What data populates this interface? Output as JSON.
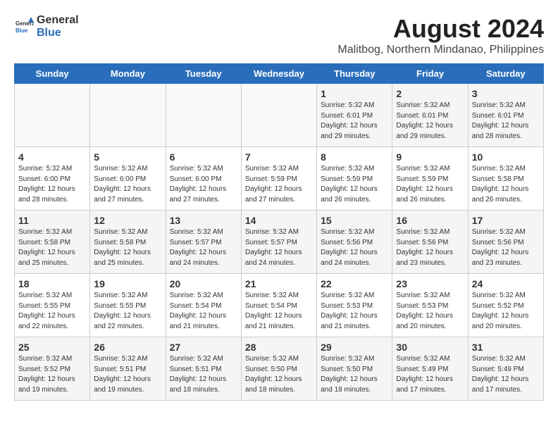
{
  "logo": {
    "text_general": "General",
    "text_blue": "Blue"
  },
  "title": "August 2024",
  "subtitle": "Malitbog, Northern Mindanao, Philippines",
  "headers": [
    "Sunday",
    "Monday",
    "Tuesday",
    "Wednesday",
    "Thursday",
    "Friday",
    "Saturday"
  ],
  "weeks": [
    [
      {
        "day": "",
        "content": ""
      },
      {
        "day": "",
        "content": ""
      },
      {
        "day": "",
        "content": ""
      },
      {
        "day": "",
        "content": ""
      },
      {
        "day": "1",
        "content": "Sunrise: 5:32 AM\nSunset: 6:01 PM\nDaylight: 12 hours\nand 29 minutes."
      },
      {
        "day": "2",
        "content": "Sunrise: 5:32 AM\nSunset: 6:01 PM\nDaylight: 12 hours\nand 29 minutes."
      },
      {
        "day": "3",
        "content": "Sunrise: 5:32 AM\nSunset: 6:01 PM\nDaylight: 12 hours\nand 28 minutes."
      }
    ],
    [
      {
        "day": "4",
        "content": "Sunrise: 5:32 AM\nSunset: 6:00 PM\nDaylight: 12 hours\nand 28 minutes."
      },
      {
        "day": "5",
        "content": "Sunrise: 5:32 AM\nSunset: 6:00 PM\nDaylight: 12 hours\nand 27 minutes."
      },
      {
        "day": "6",
        "content": "Sunrise: 5:32 AM\nSunset: 6:00 PM\nDaylight: 12 hours\nand 27 minutes."
      },
      {
        "day": "7",
        "content": "Sunrise: 5:32 AM\nSunset: 5:59 PM\nDaylight: 12 hours\nand 27 minutes."
      },
      {
        "day": "8",
        "content": "Sunrise: 5:32 AM\nSunset: 5:59 PM\nDaylight: 12 hours\nand 26 minutes."
      },
      {
        "day": "9",
        "content": "Sunrise: 5:32 AM\nSunset: 5:59 PM\nDaylight: 12 hours\nand 26 minutes."
      },
      {
        "day": "10",
        "content": "Sunrise: 5:32 AM\nSunset: 5:58 PM\nDaylight: 12 hours\nand 26 minutes."
      }
    ],
    [
      {
        "day": "11",
        "content": "Sunrise: 5:32 AM\nSunset: 5:58 PM\nDaylight: 12 hours\nand 25 minutes."
      },
      {
        "day": "12",
        "content": "Sunrise: 5:32 AM\nSunset: 5:58 PM\nDaylight: 12 hours\nand 25 minutes."
      },
      {
        "day": "13",
        "content": "Sunrise: 5:32 AM\nSunset: 5:57 PM\nDaylight: 12 hours\nand 24 minutes."
      },
      {
        "day": "14",
        "content": "Sunrise: 5:32 AM\nSunset: 5:57 PM\nDaylight: 12 hours\nand 24 minutes."
      },
      {
        "day": "15",
        "content": "Sunrise: 5:32 AM\nSunset: 5:56 PM\nDaylight: 12 hours\nand 24 minutes."
      },
      {
        "day": "16",
        "content": "Sunrise: 5:32 AM\nSunset: 5:56 PM\nDaylight: 12 hours\nand 23 minutes."
      },
      {
        "day": "17",
        "content": "Sunrise: 5:32 AM\nSunset: 5:56 PM\nDaylight: 12 hours\nand 23 minutes."
      }
    ],
    [
      {
        "day": "18",
        "content": "Sunrise: 5:32 AM\nSunset: 5:55 PM\nDaylight: 12 hours\nand 22 minutes."
      },
      {
        "day": "19",
        "content": "Sunrise: 5:32 AM\nSunset: 5:55 PM\nDaylight: 12 hours\nand 22 minutes."
      },
      {
        "day": "20",
        "content": "Sunrise: 5:32 AM\nSunset: 5:54 PM\nDaylight: 12 hours\nand 21 minutes."
      },
      {
        "day": "21",
        "content": "Sunrise: 5:32 AM\nSunset: 5:54 PM\nDaylight: 12 hours\nand 21 minutes."
      },
      {
        "day": "22",
        "content": "Sunrise: 5:32 AM\nSunset: 5:53 PM\nDaylight: 12 hours\nand 21 minutes."
      },
      {
        "day": "23",
        "content": "Sunrise: 5:32 AM\nSunset: 5:53 PM\nDaylight: 12 hours\nand 20 minutes."
      },
      {
        "day": "24",
        "content": "Sunrise: 5:32 AM\nSunset: 5:52 PM\nDaylight: 12 hours\nand 20 minutes."
      }
    ],
    [
      {
        "day": "25",
        "content": "Sunrise: 5:32 AM\nSunset: 5:52 PM\nDaylight: 12 hours\nand 19 minutes."
      },
      {
        "day": "26",
        "content": "Sunrise: 5:32 AM\nSunset: 5:51 PM\nDaylight: 12 hours\nand 19 minutes."
      },
      {
        "day": "27",
        "content": "Sunrise: 5:32 AM\nSunset: 5:51 PM\nDaylight: 12 hours\nand 18 minutes."
      },
      {
        "day": "28",
        "content": "Sunrise: 5:32 AM\nSunset: 5:50 PM\nDaylight: 12 hours\nand 18 minutes."
      },
      {
        "day": "29",
        "content": "Sunrise: 5:32 AM\nSunset: 5:50 PM\nDaylight: 12 hours\nand 18 minutes."
      },
      {
        "day": "30",
        "content": "Sunrise: 5:32 AM\nSunset: 5:49 PM\nDaylight: 12 hours\nand 17 minutes."
      },
      {
        "day": "31",
        "content": "Sunrise: 5:32 AM\nSunset: 5:49 PM\nDaylight: 12 hours\nand 17 minutes."
      }
    ]
  ]
}
